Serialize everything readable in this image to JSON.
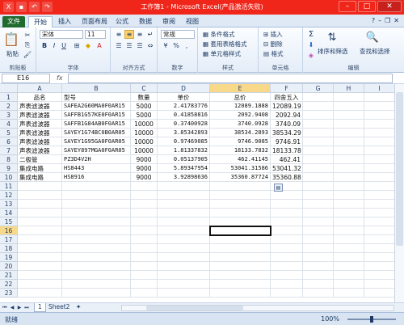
{
  "titlebar": {
    "title": "工作簿1 - Microsoft Excel(产品激活失败)"
  },
  "tabs": [
    "文件",
    "开始",
    "插入",
    "页面布局",
    "公式",
    "数据",
    "审阅",
    "视图"
  ],
  "ribbon": {
    "paste_label": "粘贴",
    "font_name": "宋体",
    "font_size": "11",
    "number_format": "常规",
    "group_labels": [
      "剪贴板",
      "字体",
      "对齐方式",
      "数字",
      "样式",
      "单元格",
      "编辑"
    ],
    "styles": [
      "条件格式",
      "套用表格格式",
      "单元格样式"
    ],
    "cells": [
      "插入",
      "删除",
      "格式"
    ],
    "sort_label": "排序和筛选",
    "find_label": "查找和选择",
    "bold": "B",
    "italic": "I",
    "underline": "U",
    "percent": "%",
    "comma": ","
  },
  "formula_bar": {
    "cell_ref": "E16",
    "fx": "fx",
    "content": ""
  },
  "columns": [
    "A",
    "B",
    "C",
    "D",
    "E",
    "F",
    "G",
    "H",
    "I"
  ],
  "rows": [
    "1",
    "2",
    "3",
    "4",
    "5",
    "6",
    "7",
    "8",
    "9",
    "10",
    "11",
    "12",
    "13",
    "14",
    "15",
    "16",
    "17",
    "18",
    "19",
    "20",
    "21",
    "22",
    "23"
  ],
  "table": {
    "header": [
      "品名",
      "型号",
      "数量",
      "单价",
      "总价",
      "四舍五入"
    ],
    "data": [
      [
        "声表滤波器",
        "SAFEA2G60MA0F0AR15",
        "5000",
        "2.41783776",
        "12089.1888",
        "12089.19"
      ],
      [
        "声表滤波器",
        "SAFFB1G57KE0F0AR15",
        "5000",
        "0.41858816",
        "2092.9408",
        "2092.94"
      ],
      [
        "声表滤波器",
        "SAFFB1G84AB0F0AR15",
        "10000",
        "0.37400928",
        "3740.0928",
        "3740.09"
      ],
      [
        "声表滤波器",
        "SAYEY1G74BC0B0AR05",
        "10000",
        "3.85342893",
        "38534.2893",
        "38534.29"
      ],
      [
        "声表滤波器",
        "SAYEY1G95GA0F0AR05",
        "10000",
        "0.97469085",
        "9746.9085",
        "9746.91"
      ],
      [
        "声表滤波器",
        "SAYEY897MGA0F0AR05",
        "10000",
        "1.81337832",
        "18133.7832",
        "18133.78"
      ],
      [
        "二极管",
        "PZ3D4V2H",
        "9000",
        "0.05137905",
        "462.41145",
        "462.41"
      ],
      [
        "集成电路",
        "HS8443",
        "9000",
        "5.89347954",
        "53041.31586",
        "53041.32"
      ],
      [
        "集成电路",
        "HS8916",
        "9000",
        "3.92898636",
        "35360.87724",
        "35360.88"
      ]
    ]
  },
  "sheets": [
    "1",
    "Sheet2"
  ],
  "status": {
    "ready": "就绪",
    "zoom": "100%"
  }
}
